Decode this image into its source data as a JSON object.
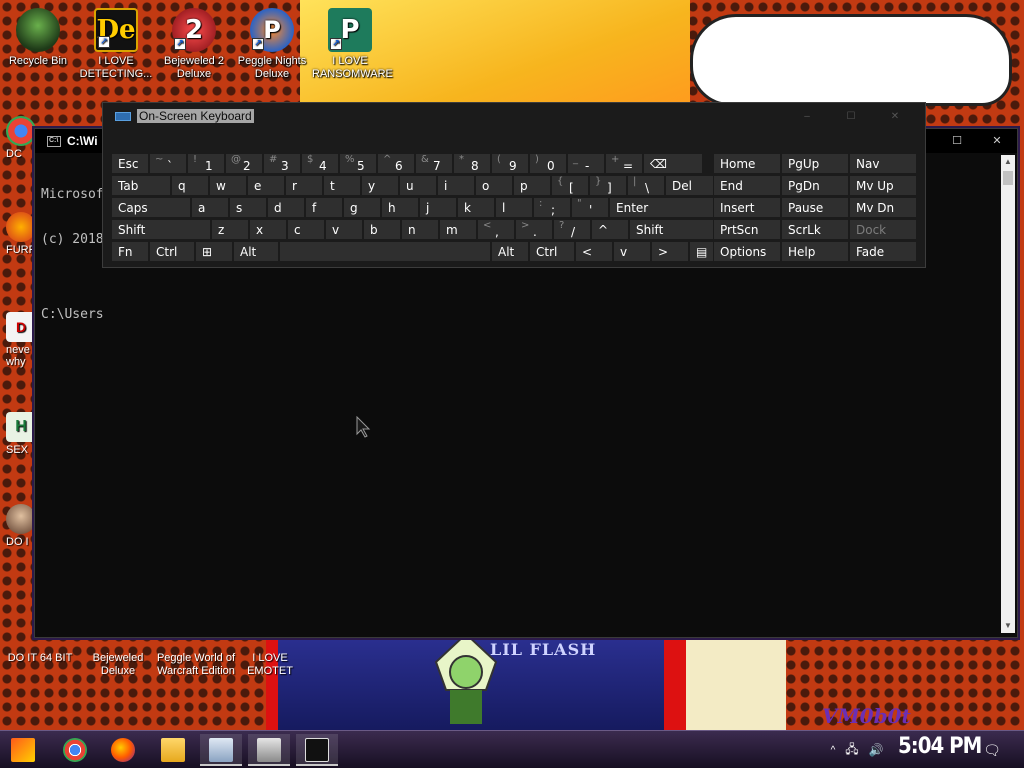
{
  "desktop": {
    "top_icons": [
      {
        "label": "Recycle Bin",
        "icon": "recycle-bin-icon",
        "glyph": ""
      },
      {
        "label": "I LOVE DETECTING...",
        "icon": "detective-app-icon",
        "glyph": "De"
      },
      {
        "label": "Bejeweled 2 Deluxe",
        "icon": "bejeweled-icon",
        "glyph": "2"
      },
      {
        "label": "Peggle Nights Deluxe",
        "icon": "peggle-icon",
        "glyph": "P"
      },
      {
        "label": "I LOVE RANSOMWARE",
        "icon": "publisher-icon",
        "glyph": "P"
      }
    ],
    "left_icons": [
      {
        "label": "DC",
        "icon": "chrome-icon"
      },
      {
        "label": "FURF",
        "icon": "firefox-icon"
      },
      {
        "label": "neve why",
        "icon": "text-file-icon"
      },
      {
        "label": "SEX",
        "icon": "app-icon"
      },
      {
        "label": "DO I",
        "icon": "person-icon"
      },
      {
        "label": "DO I",
        "icon": "person-icon"
      }
    ],
    "bottom_icons": [
      {
        "label": "DO IT 64 BIT",
        "icon": "app-icon"
      },
      {
        "label": "Bejeweled Deluxe",
        "icon": "bejeweled-icon"
      },
      {
        "label": "Peggle World of Warcraft Edition",
        "icon": "peggle-icon"
      },
      {
        "label": "I LOVE EMOTET",
        "icon": "app-icon"
      }
    ],
    "wallpaper": {
      "art_title": "LIL FLASH",
      "signature": "VM0b0t"
    }
  },
  "console": {
    "title": "C:\\Wi",
    "lines": [
      "Microsof",
      "(c) 2018",
      "",
      "C:\\Users"
    ],
    "buttons": {
      "minimize": "–",
      "maximize": "☐",
      "close": "✕"
    }
  },
  "osk": {
    "title": "On-Screen Keyboard",
    "rows": [
      [
        {
          "main": "Esc"
        },
        {
          "shift": "~",
          "main": "`"
        },
        {
          "shift": "!",
          "main": "1"
        },
        {
          "shift": "@",
          "main": "2"
        },
        {
          "shift": "#",
          "main": "3"
        },
        {
          "shift": "$",
          "main": "4"
        },
        {
          "shift": "%",
          "main": "5"
        },
        {
          "shift": "^",
          "main": "6"
        },
        {
          "shift": "&",
          "main": "7"
        },
        {
          "shift": "*",
          "main": "8"
        },
        {
          "shift": "(",
          "main": "9"
        },
        {
          "shift": ")",
          "main": "0"
        },
        {
          "shift": "_",
          "main": "-"
        },
        {
          "shift": "+",
          "main": "="
        },
        {
          "main": "⌫"
        }
      ],
      [
        {
          "main": "Tab"
        },
        {
          "main": "q"
        },
        {
          "main": "w"
        },
        {
          "main": "e"
        },
        {
          "main": "r"
        },
        {
          "main": "t"
        },
        {
          "main": "y"
        },
        {
          "main": "u"
        },
        {
          "main": "i"
        },
        {
          "main": "o"
        },
        {
          "main": "p"
        },
        {
          "shift": "{",
          "main": "["
        },
        {
          "shift": "}",
          "main": "]"
        },
        {
          "shift": "|",
          "main": "\\"
        },
        {
          "main": "Del"
        }
      ],
      [
        {
          "main": "Caps"
        },
        {
          "main": "a"
        },
        {
          "main": "s"
        },
        {
          "main": "d"
        },
        {
          "main": "f"
        },
        {
          "main": "g"
        },
        {
          "main": "h"
        },
        {
          "main": "j"
        },
        {
          "main": "k"
        },
        {
          "main": "l"
        },
        {
          "shift": ":",
          "main": ";"
        },
        {
          "shift": "\"",
          "main": "'"
        },
        {
          "main": "Enter"
        }
      ],
      [
        {
          "main": "Shift"
        },
        {
          "main": "z"
        },
        {
          "main": "x"
        },
        {
          "main": "c"
        },
        {
          "main": "v"
        },
        {
          "main": "b"
        },
        {
          "main": "n"
        },
        {
          "main": "m"
        },
        {
          "shift": "<",
          "main": ","
        },
        {
          "shift": ">",
          "main": "."
        },
        {
          "shift": "?",
          "main": "/"
        },
        {
          "main": "^"
        },
        {
          "main": "Shift"
        }
      ],
      [
        {
          "main": "Fn"
        },
        {
          "main": "Ctrl"
        },
        {
          "main": "⊞"
        },
        {
          "main": "Alt"
        },
        {
          "main": ""
        },
        {
          "main": "Alt"
        },
        {
          "main": "Ctrl"
        },
        {
          "main": "<"
        },
        {
          "main": "v"
        },
        {
          "main": ">"
        },
        {
          "main": "▤"
        }
      ]
    ],
    "nav_rows": [
      [
        "Home",
        "PgUp",
        "Nav"
      ],
      [
        "End",
        "PgDn",
        "Mv Up"
      ],
      [
        "Insert",
        "Pause",
        "Mv Dn"
      ],
      [
        "PrtScn",
        "ScrLk",
        "Dock"
      ],
      [
        "Options",
        "Help",
        "Fade"
      ]
    ],
    "buttons": {
      "minimize": "–",
      "maximize": "☐",
      "close": "✕"
    }
  },
  "taskbar": {
    "clock": "5:04 PM",
    "apps": [
      {
        "name": "start-button",
        "icon": "start-icon"
      },
      {
        "name": "chrome",
        "icon": "chrome-icon"
      },
      {
        "name": "firefox",
        "icon": "firefox-icon"
      },
      {
        "name": "file-explorer",
        "icon": "folder-icon"
      },
      {
        "name": "image-viewer",
        "icon": "image-icon"
      },
      {
        "name": "keyboard",
        "icon": "keyboard-icon"
      },
      {
        "name": "console",
        "icon": "console-icon"
      }
    ],
    "tray_icons": [
      "chevron-up-icon",
      "network-icon",
      "volume-icon"
    ],
    "notification_icon": "action-center-icon"
  },
  "colors": {
    "wallpaper_red": "#c23a12",
    "osk_bg": "#1b1b1b",
    "key_bg": "#2f2f2f",
    "taskbar": "#2a1e3a"
  }
}
